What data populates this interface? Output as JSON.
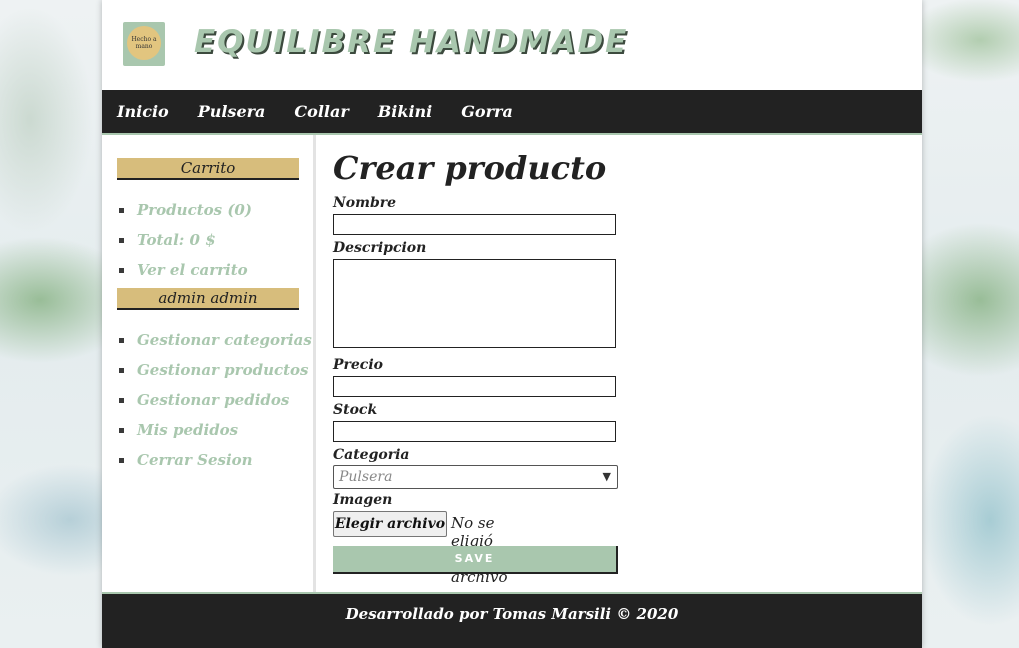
{
  "header": {
    "logo_text": "Hecho a mano",
    "title": "EQUILIBRE HANDMADE"
  },
  "nav": {
    "items": [
      "Inicio",
      "Pulsera",
      "Collar",
      "Bikini",
      "Gorra"
    ]
  },
  "sidebar": {
    "cart_heading": "Carrito",
    "cart_items": [
      "Productos (0)",
      "Total: 0 $",
      "Ver el carrito"
    ],
    "user_heading": "admin admin",
    "admin_items": [
      "Gestionar categorias",
      "Gestionar productos",
      "Gestionar pedidos",
      "Mis pedidos",
      "Cerrar Sesion"
    ]
  },
  "form": {
    "heading": "Crear producto",
    "nombre_label": "Nombre",
    "nombre_value": "",
    "descripcion_label": "Descripcion",
    "descripcion_value": "",
    "precio_label": "Precio",
    "precio_value": "",
    "stock_label": "Stock",
    "stock_value": "",
    "categoria_label": "Categoria",
    "categoria_selected": "Pulsera",
    "imagen_label": "Imagen",
    "file_button": "Elegir archivo",
    "file_status": "No se eligió ningún archivo",
    "save_label": "SAVE"
  },
  "footer": {
    "text": "Desarrollado por Tomas Marsili © 2020"
  },
  "colors": {
    "accent_green": "#a9c7ae",
    "accent_gold": "#d7bd7c",
    "dark": "#222222"
  }
}
